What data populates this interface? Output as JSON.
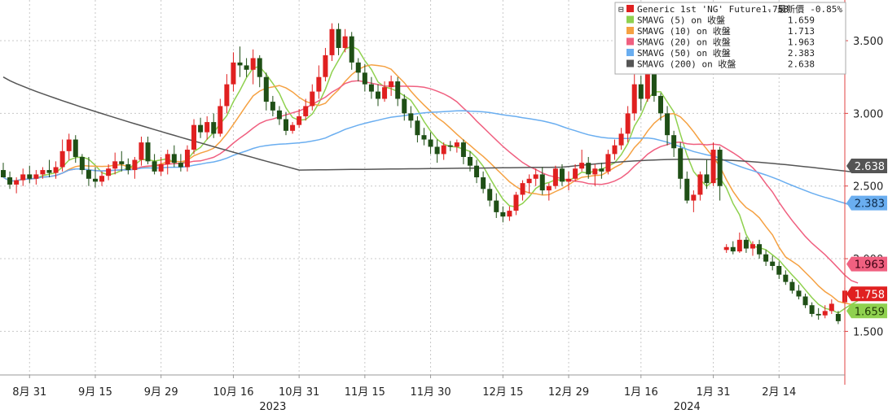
{
  "chart_data": {
    "type": "candlestick",
    "y_axis": {
      "position": "right",
      "ticks": [
        "1.500",
        "2.000",
        "2.500",
        "3.000",
        "3.500"
      ],
      "tick_values": [
        1.5,
        2.0,
        2.5,
        3.0,
        3.5
      ],
      "ylim": [
        1.2,
        3.78
      ]
    },
    "x_axis": {
      "ticks": [
        "8月 31",
        "9月 15",
        "9月 29",
        "10月 16",
        "10月 31",
        "11月 15",
        "11月 30",
        "12月 15",
        "12月 29",
        "1月 16",
        "1月 31",
        "2月 14"
      ],
      "tick_index": [
        4,
        14,
        24,
        35,
        45,
        55,
        65,
        76,
        86,
        97,
        108,
        118
      ],
      "year_labels": [
        {
          "text": "2023",
          "index": 41
        },
        {
          "text": "2024",
          "index": 104
        }
      ]
    },
    "grid": true,
    "legend": {
      "placement": "top-right",
      "entries": [
        {
          "label": "Generic 1st 'NG' Future - 最新價",
          "value": "1.758",
          "change": "-0.85%",
          "color": "#e02020"
        },
        {
          "label": "SMAVG (5)  on 收盤",
          "value": "1.659",
          "color": "#8fd14f"
        },
        {
          "label": "SMAVG (10)  on 收盤",
          "value": "1.713",
          "color": "#f5a142"
        },
        {
          "label": "SMAVG (20)  on 收盤",
          "value": "1.963",
          "color": "#f06080"
        },
        {
          "label": "SMAVG (50)  on 收盤",
          "value": "2.383",
          "color": "#6aaef0"
        },
        {
          "label": "SMAVG (200)  on 收盤",
          "value": "2.638",
          "color": "#555555"
        }
      ]
    },
    "value_tags": [
      {
        "text": "2.638",
        "value": 2.638,
        "bg": "#555555",
        "fg": "#ffffff"
      },
      {
        "text": "2.383",
        "value": 2.383,
        "bg": "#6aaef0",
        "fg": "#0d2a4a"
      },
      {
        "text": "1.963",
        "value": 1.963,
        "bg": "#f06080",
        "fg": "#3a0010"
      },
      {
        "text": "1.758",
        "value": 1.758,
        "bg": "#e02020",
        "fg": "#ffffff"
      },
      {
        "text": "1.659",
        "value": 1.659,
        "bg": "#8fd14f",
        "fg": "#1f3a05"
      }
    ],
    "candles": [
      [
        2.61,
        2.66,
        2.58,
        2.56
      ],
      [
        2.56,
        2.6,
        2.48,
        2.51
      ],
      [
        2.51,
        2.56,
        2.45,
        2.54
      ],
      [
        2.54,
        2.62,
        2.5,
        2.58
      ],
      [
        2.58,
        2.64,
        2.52,
        2.55
      ],
      [
        2.55,
        2.61,
        2.51,
        2.58
      ],
      [
        2.58,
        2.63,
        2.55,
        2.61
      ],
      [
        2.61,
        2.68,
        2.56,
        2.59
      ],
      [
        2.59,
        2.67,
        2.55,
        2.63
      ],
      [
        2.63,
        2.82,
        2.6,
        2.74
      ],
      [
        2.74,
        2.86,
        2.68,
        2.82
      ],
      [
        2.82,
        2.85,
        2.66,
        2.7
      ],
      [
        2.7,
        2.72,
        2.58,
        2.61
      ],
      [
        2.61,
        2.7,
        2.5,
        2.55
      ],
      [
        2.55,
        2.63,
        2.49,
        2.53
      ],
      [
        2.53,
        2.6,
        2.5,
        2.57
      ],
      [
        2.57,
        2.65,
        2.54,
        2.62
      ],
      [
        2.62,
        2.73,
        2.58,
        2.67
      ],
      [
        2.67,
        2.74,
        2.6,
        2.65
      ],
      [
        2.65,
        2.69,
        2.58,
        2.61
      ],
      [
        2.61,
        2.7,
        2.55,
        2.68
      ],
      [
        2.68,
        2.84,
        2.64,
        2.8
      ],
      [
        2.8,
        2.84,
        2.65,
        2.67
      ],
      [
        2.67,
        2.72,
        2.58,
        2.6
      ],
      [
        2.6,
        2.7,
        2.57,
        2.65
      ],
      [
        2.65,
        2.75,
        2.58,
        2.72
      ],
      [
        2.72,
        2.78,
        2.63,
        2.66
      ],
      [
        2.66,
        2.72,
        2.6,
        2.63
      ],
      [
        2.63,
        2.78,
        2.6,
        2.75
      ],
      [
        2.75,
        2.96,
        2.72,
        2.92
      ],
      [
        2.92,
        2.97,
        2.83,
        2.87
      ],
      [
        2.87,
        2.98,
        2.82,
        2.94
      ],
      [
        2.94,
        3.0,
        2.83,
        2.86
      ],
      [
        2.86,
        3.1,
        2.84,
        3.05
      ],
      [
        3.05,
        3.27,
        3.0,
        3.2
      ],
      [
        3.2,
        3.42,
        3.15,
        3.35
      ],
      [
        3.35,
        3.46,
        3.25,
        3.33
      ],
      [
        3.33,
        3.38,
        3.25,
        3.3
      ],
      [
        3.3,
        3.44,
        3.2,
        3.38
      ],
      [
        3.38,
        3.4,
        3.18,
        3.25
      ],
      [
        3.25,
        3.28,
        3.02,
        3.08
      ],
      [
        3.08,
        3.12,
        2.98,
        3.02
      ],
      [
        3.02,
        3.05,
        2.92,
        2.96
      ],
      [
        2.96,
        3.01,
        2.85,
        2.88
      ],
      [
        2.88,
        2.94,
        2.86,
        2.92
      ],
      [
        2.92,
        3.03,
        2.9,
        2.98
      ],
      [
        2.98,
        3.1,
        2.95,
        3.05
      ],
      [
        3.05,
        3.2,
        3.02,
        3.15
      ],
      [
        3.15,
        3.33,
        3.1,
        3.25
      ],
      [
        3.25,
        3.45,
        3.22,
        3.4
      ],
      [
        3.4,
        3.62,
        3.36,
        3.58
      ],
      [
        3.58,
        3.62,
        3.4,
        3.45
      ],
      [
        3.45,
        3.58,
        3.42,
        3.53
      ],
      [
        3.53,
        3.56,
        3.3,
        3.35
      ],
      [
        3.35,
        3.38,
        3.22,
        3.28
      ],
      [
        3.28,
        3.34,
        3.15,
        3.2
      ],
      [
        3.2,
        3.25,
        3.1,
        3.15
      ],
      [
        3.15,
        3.2,
        3.05,
        3.1
      ],
      [
        3.1,
        3.22,
        3.08,
        3.18
      ],
      [
        3.18,
        3.26,
        3.12,
        3.22
      ],
      [
        3.22,
        3.25,
        3.05,
        3.1
      ],
      [
        3.1,
        3.13,
        2.95,
        3.0
      ],
      [
        3.0,
        3.05,
        2.9,
        2.95
      ],
      [
        2.95,
        2.98,
        2.8,
        2.85
      ],
      [
        2.85,
        2.9,
        2.78,
        2.82
      ],
      [
        2.82,
        2.87,
        2.72,
        2.77
      ],
      [
        2.77,
        2.82,
        2.66,
        2.72
      ],
      [
        2.72,
        2.8,
        2.68,
        2.78
      ],
      [
        2.78,
        2.81,
        2.74,
        2.77
      ],
      [
        2.77,
        2.82,
        2.73,
        2.8
      ],
      [
        2.8,
        2.82,
        2.65,
        2.7
      ],
      [
        2.7,
        2.74,
        2.6,
        2.64
      ],
      [
        2.64,
        2.68,
        2.52,
        2.56
      ],
      [
        2.56,
        2.6,
        2.45,
        2.48
      ],
      [
        2.48,
        2.52,
        2.36,
        2.4
      ],
      [
        2.4,
        2.45,
        2.28,
        2.32
      ],
      [
        2.32,
        2.36,
        2.25,
        2.29
      ],
      [
        2.29,
        2.36,
        2.26,
        2.33
      ],
      [
        2.33,
        2.46,
        2.3,
        2.44
      ],
      [
        2.44,
        2.54,
        2.4,
        2.52
      ],
      [
        2.52,
        2.58,
        2.45,
        2.55
      ],
      [
        2.55,
        2.62,
        2.5,
        2.58
      ],
      [
        2.58,
        2.63,
        2.44,
        2.47
      ],
      [
        2.47,
        2.52,
        2.4,
        2.5
      ],
      [
        2.5,
        2.64,
        2.48,
        2.62
      ],
      [
        2.62,
        2.65,
        2.5,
        2.53
      ],
      [
        2.53,
        2.6,
        2.47,
        2.55
      ],
      [
        2.55,
        2.65,
        2.53,
        2.62
      ],
      [
        2.62,
        2.75,
        2.6,
        2.66
      ],
      [
        2.66,
        2.7,
        2.55,
        2.58
      ],
      [
        2.58,
        2.65,
        2.5,
        2.62
      ],
      [
        2.62,
        2.66,
        2.55,
        2.6
      ],
      [
        2.6,
        2.75,
        2.58,
        2.72
      ],
      [
        2.72,
        2.82,
        2.68,
        2.78
      ],
      [
        2.78,
        2.9,
        2.75,
        2.86
      ],
      [
        2.86,
        3.05,
        2.8,
        3.0
      ],
      [
        3.0,
        3.3,
        2.95,
        3.2
      ],
      [
        3.2,
        3.26,
        3.02,
        3.1
      ],
      [
        3.1,
        3.4,
        3.08,
        3.32
      ],
      [
        3.32,
        3.45,
        3.08,
        3.12
      ],
      [
        3.12,
        3.14,
        2.95,
        3.0
      ],
      [
        3.0,
        3.05,
        2.78,
        2.85
      ],
      [
        2.85,
        2.88,
        2.7,
        2.76
      ],
      [
        2.76,
        2.8,
        2.48,
        2.55
      ],
      [
        2.55,
        2.6,
        2.38,
        2.4
      ],
      [
        2.4,
        2.47,
        2.32,
        2.44
      ],
      [
        2.44,
        2.6,
        2.4,
        2.58
      ],
      [
        2.58,
        2.68,
        2.48,
        2.52
      ],
      [
        2.52,
        2.8,
        2.5,
        2.75
      ],
      [
        2.75,
        2.77,
        2.4,
        2.5
      ],
      [
        2.06,
        2.1,
        2.04,
        2.08
      ],
      [
        2.08,
        2.12,
        2.03,
        2.05
      ],
      [
        2.05,
        2.18,
        2.04,
        2.13
      ],
      [
        2.13,
        2.15,
        2.04,
        2.07
      ],
      [
        2.07,
        2.12,
        2.02,
        2.1
      ],
      [
        2.1,
        2.13,
        2.0,
        2.03
      ],
      [
        2.03,
        2.06,
        1.95,
        1.98
      ],
      [
        1.98,
        2.02,
        1.92,
        1.95
      ],
      [
        1.95,
        1.98,
        1.86,
        1.89
      ],
      [
        1.89,
        1.92,
        1.82,
        1.84
      ],
      [
        1.84,
        1.86,
        1.76,
        1.78
      ],
      [
        1.78,
        1.82,
        1.72,
        1.74
      ],
      [
        1.74,
        1.76,
        1.66,
        1.68
      ],
      [
        1.68,
        1.7,
        1.6,
        1.62
      ],
      [
        1.62,
        1.66,
        1.58,
        1.61
      ],
      [
        1.61,
        1.68,
        1.59,
        1.64
      ],
      [
        1.64,
        1.72,
        1.62,
        1.69
      ],
      [
        1.62,
        1.64,
        1.55,
        1.57
      ],
      [
        1.7,
        1.8,
        1.68,
        1.78
      ],
      [
        1.77,
        1.79,
        1.72,
        1.75
      ],
      [
        1.76,
        1.79,
        1.75,
        1.758
      ]
    ]
  }
}
